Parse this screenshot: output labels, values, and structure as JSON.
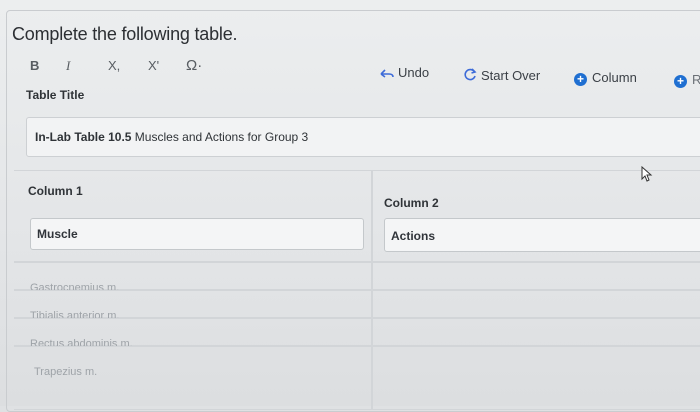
{
  "prompt": "Complete the following table.",
  "toolbar": {
    "bold": "B",
    "italic": "I",
    "subscript": "X,",
    "superscript": "X'",
    "special_chars": "Ω·",
    "undo": "Undo",
    "start_over": "Start Over",
    "column": "Column",
    "row": "R"
  },
  "table_title": {
    "label": "Table Title",
    "value_bold": "In-Lab Table 10.5",
    "value_rest": " Muscles and Actions for Group 3"
  },
  "columns": [
    {
      "label": "Column 1",
      "header": "Muscle"
    },
    {
      "label": "Column 2",
      "header": "Actions"
    }
  ],
  "rows": [
    {
      "c1": "Gastrocnemius m.",
      "c2": ""
    },
    {
      "c1": "Tibialis anterior m.",
      "c2": ""
    },
    {
      "c1": "Rectus abdominis m.",
      "c2": ""
    },
    {
      "c1": "Trapezius m.",
      "c2": ""
    }
  ],
  "colors": {
    "accent": "#1f6fd1",
    "text": "#2f3337",
    "placeholder": "#9ea3a8"
  }
}
